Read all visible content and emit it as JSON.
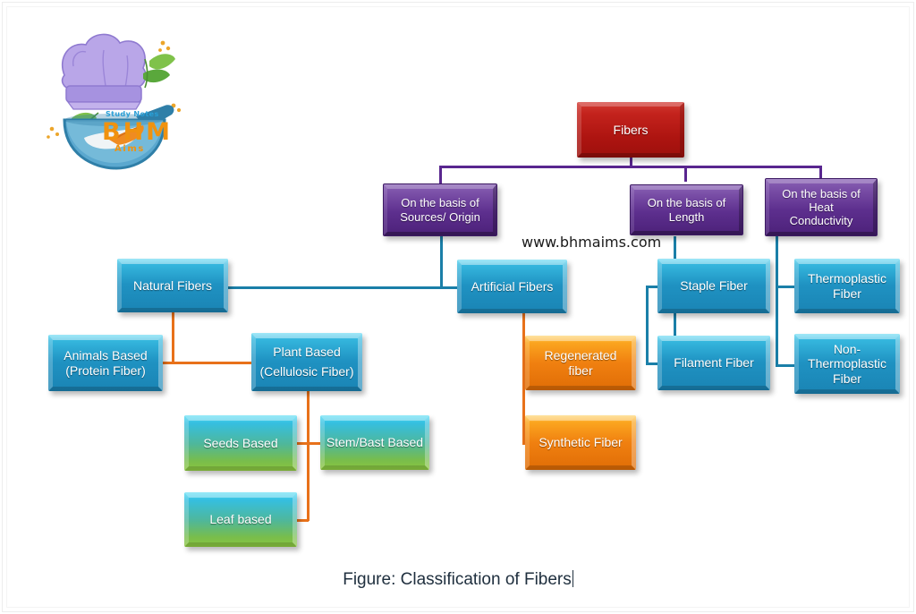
{
  "figure": {
    "caption": "Figure: Classification of Fibers",
    "watermark": "www.bhmaims.com"
  },
  "logo": {
    "line1": "Study Notes",
    "line2": "BHM",
    "line3": "Aims",
    "hat_icon": "chef-hat-icon",
    "pan_icon": "frying-pan-icon",
    "leaf_icon": "leaf-icon"
  },
  "colors": {
    "root": "#b51714",
    "category": "#5d2f8e",
    "primary": "#1f92c2",
    "accent": "#f08010",
    "plant": "#78bd4c",
    "connector_purple": "#59268f",
    "connector_blue": "#1a7fa8",
    "connector_orange": "#e8711a"
  },
  "chart_data": {
    "type": "diagram",
    "title": "Figure: Classification of Fibers",
    "layout": "top-down hierarchy tree",
    "nodes": [
      {
        "id": "fibers",
        "label": "Fibers",
        "level": 0,
        "color": "#b51714"
      },
      {
        "id": "basis_sources",
        "label": "On the  basis of Sources/ Origin",
        "level": 1,
        "color": "#5d2f8e"
      },
      {
        "id": "basis_length",
        "label": "On the basis of Length",
        "level": 1,
        "color": "#5d2f8e"
      },
      {
        "id": "basis_heat",
        "label": "On the basis of Heat Conductivity",
        "level": 1,
        "color": "#5d2f8e"
      },
      {
        "id": "natural",
        "label": "Natural Fibers",
        "level": 2,
        "color": "#1f92c2"
      },
      {
        "id": "artificial",
        "label": "Artificial Fibers",
        "level": 2,
        "color": "#1f92c2"
      },
      {
        "id": "staple",
        "label": "Staple Fiber",
        "level": 2,
        "color": "#1f92c2"
      },
      {
        "id": "filament",
        "label": "Filament Fiber",
        "level": 2,
        "color": "#1f92c2"
      },
      {
        "id": "thermoplastic",
        "label": "Thermoplastic Fiber",
        "level": 2,
        "color": "#1f92c2"
      },
      {
        "id": "non_thermoplastic",
        "label": "Non-Thermoplastic Fiber",
        "level": 2,
        "color": "#1f92c2"
      },
      {
        "id": "animals",
        "label": "Animals Based (Protein Fiber)",
        "level": 3,
        "color": "#1f92c2"
      },
      {
        "id": "plant",
        "label": "Plant Based (Cellulosic Fiber)",
        "level": 3,
        "color": "#1f92c2"
      },
      {
        "id": "regenerated",
        "label": "Regenerated fiber",
        "level": 3,
        "color": "#f08010"
      },
      {
        "id": "synthetic",
        "label": "Synthetic Fiber",
        "level": 3,
        "color": "#f08010"
      },
      {
        "id": "seeds",
        "label": "Seeds Based",
        "level": 4,
        "color": "#78bd4c"
      },
      {
        "id": "stem_bast",
        "label": "Stem/Bast Based",
        "level": 4,
        "color": "#78bd4c"
      },
      {
        "id": "leaf",
        "label": "Leaf based",
        "level": 4,
        "color": "#78bd4c"
      }
    ],
    "edges": [
      {
        "from": "fibers",
        "to": "basis_sources"
      },
      {
        "from": "fibers",
        "to": "basis_length"
      },
      {
        "from": "fibers",
        "to": "basis_heat"
      },
      {
        "from": "basis_sources",
        "to": "natural"
      },
      {
        "from": "basis_sources",
        "to": "artificial"
      },
      {
        "from": "basis_length",
        "to": "staple"
      },
      {
        "from": "basis_length",
        "to": "filament"
      },
      {
        "from": "basis_heat",
        "to": "thermoplastic"
      },
      {
        "from": "basis_heat",
        "to": "non_thermoplastic"
      },
      {
        "from": "natural",
        "to": "animals"
      },
      {
        "from": "natural",
        "to": "plant"
      },
      {
        "from": "artificial",
        "to": "regenerated"
      },
      {
        "from": "artificial",
        "to": "synthetic"
      },
      {
        "from": "plant",
        "to": "seeds"
      },
      {
        "from": "plant",
        "to": "stem_bast"
      },
      {
        "from": "plant",
        "to": "leaf"
      }
    ]
  },
  "nodes": {
    "fibers": "Fibers",
    "basis_sources_l1": "On the  basis of",
    "basis_sources_l2": "Sources/ Origin",
    "basis_length_l1": "On the basis of",
    "basis_length_l2": "Length",
    "basis_heat_l1": "On the basis of",
    "basis_heat_l2": "Heat",
    "basis_heat_l3": "Conductivity",
    "natural": "Natural Fibers",
    "artificial": "Artificial Fibers",
    "staple": "Staple Fiber",
    "filament": "Filament Fiber",
    "thermoplastic_l1": "Thermoplastic",
    "thermoplastic_l2": "Fiber",
    "non_thermoplastic_l1": "Non-",
    "non_thermoplastic_l2": "Thermoplastic",
    "non_thermoplastic_l3": "Fiber",
    "animals_l1": "Animals Based",
    "animals_l2": "(Protein Fiber)",
    "plant_l1": "Plant Based",
    "plant_l2": "(Cellulosic Fiber)",
    "regenerated": "Regenerated fiber",
    "synthetic": "Synthetic Fiber",
    "seeds": "Seeds Based",
    "stem_bast": "Stem/Bast Based",
    "leaf": "Leaf based"
  }
}
